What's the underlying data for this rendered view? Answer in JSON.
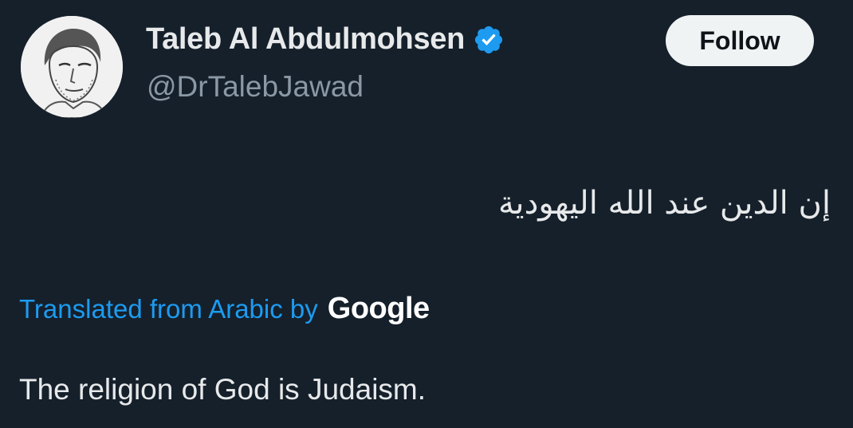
{
  "author": {
    "display_name": "Taleb Al Abdulmohsen",
    "handle": "@DrTalebJawad",
    "verified_icon": "verified-badge-icon",
    "avatar_icon": "profile-avatar"
  },
  "follow_button": {
    "label": "Follow"
  },
  "tweet": {
    "original_text": "إن الدين عند الله اليهودية",
    "translation_note": "Translated from Arabic by",
    "translation_provider": "Google",
    "translated_text": "The religion of God is Judaism."
  },
  "colors": {
    "background": "#15202b",
    "primary_text": "#e7e9ea",
    "secondary_text": "#8b98a5",
    "link": "#1d9bf0",
    "verified": "#1d9bf0",
    "follow_bg": "#eff3f4"
  }
}
